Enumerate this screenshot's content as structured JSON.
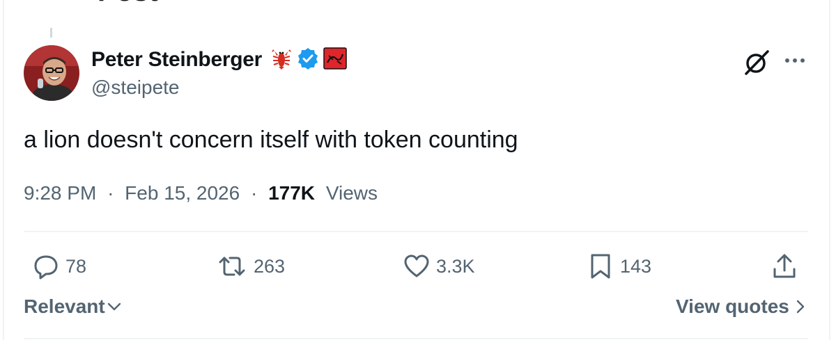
{
  "header": {
    "title": "Post"
  },
  "author": {
    "display_name": "Peter Steinberger",
    "handle": "@steipete",
    "avatar_icon": "person-avatar",
    "badges": [
      "lobster-emoji-icon",
      "verified-badge-icon",
      "affiliate-badge-icon"
    ],
    "verified_color": "#1d9bf0"
  },
  "tweet": {
    "text": "a lion doesn't concern itself with token counting"
  },
  "meta": {
    "time": "9:28 PM",
    "separator": "·",
    "date": "Feb 15, 2026",
    "views_count": "177K",
    "views_label": "Views"
  },
  "actions": {
    "replies": {
      "icon": "reply-icon",
      "count": "78"
    },
    "reposts": {
      "icon": "repost-icon",
      "count": "263"
    },
    "likes": {
      "icon": "heart-icon",
      "count": "3.3K"
    },
    "bookmarks": {
      "icon": "bookmark-icon",
      "count": "143"
    },
    "share": {
      "icon": "share-icon"
    }
  },
  "footer": {
    "sort_label": "Relevant",
    "quotes_label": "View quotes"
  },
  "colors": {
    "text_primary": "#0f1419",
    "text_secondary": "#536471",
    "divider": "#eff3f4",
    "accent": "#1d9bf0"
  }
}
